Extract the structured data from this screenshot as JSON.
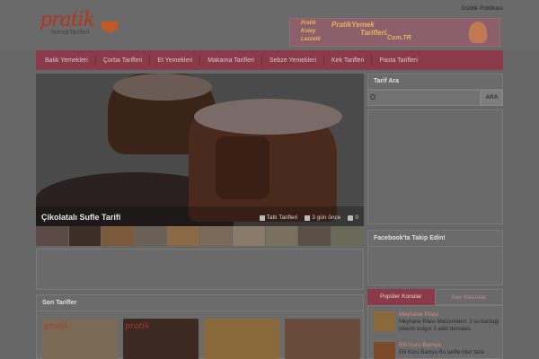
{
  "header": {
    "logo_main": "pratik",
    "logo_sub": "YemekTarifleri",
    "privacy_link": "Gizlilik Politikası",
    "banner": {
      "line1": "Pratik",
      "line2": "Kolay",
      "line3": "Lezzetli",
      "brand": "PratikYemek",
      "tarif": "Tarifleri.",
      "domain": "Com.TR"
    }
  },
  "nav": {
    "items": [
      {
        "label": "Balık Yemekleri"
      },
      {
        "label": "Çorba Tarifleri"
      },
      {
        "label": "Et Yemekleri"
      },
      {
        "label": "Makarna Tarifleri"
      },
      {
        "label": "Sebze Yemekleri"
      },
      {
        "label": "Kek Tarifleri"
      },
      {
        "label": "Pasta Tarifleri"
      }
    ]
  },
  "slider": {
    "title": "Çikolatalı Sufle Tarifi",
    "category": "Tatlı Tarifleri",
    "time": "3 gün önce",
    "comments": "0"
  },
  "sidebar": {
    "search_title": "Tarif Ara",
    "search_placeholder": "",
    "search_button": "ARA",
    "facebook_title": "Facebook'ta Takip Edin!",
    "tabs": [
      {
        "label": "Popüler Konular"
      },
      {
        "label": "Son Yorumlar"
      }
    ],
    "popular": [
      {
        "title": "Meyhane Pilavı",
        "text": "Meyhane Pilavı Malzemeleri: 2 su bardağı pilavlık bulgur 2 adet domates"
      },
      {
        "title": "Etli Kuru Bamya",
        "text": "Etli Kuru Bamya Bu tarifle inter taze"
      }
    ]
  },
  "main": {
    "son_tarifler_title": "Son Tarifler",
    "recipe_stamp": "pratik"
  }
}
